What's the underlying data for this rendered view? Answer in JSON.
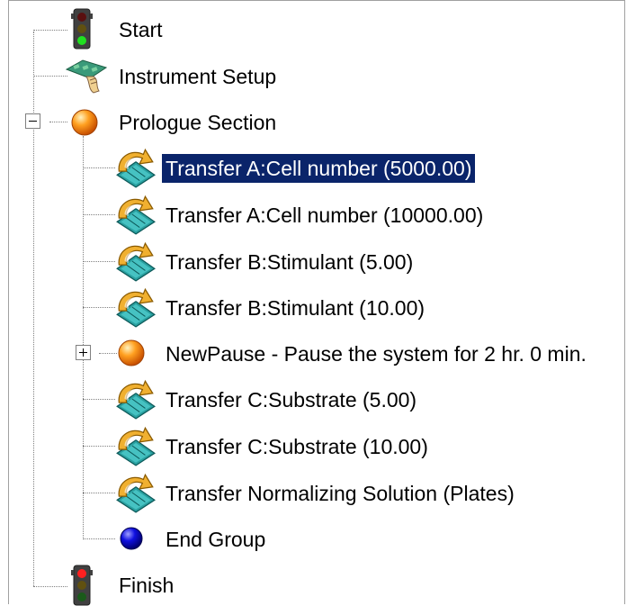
{
  "tree": {
    "root_items": {
      "start": {
        "label": "Start",
        "icon": "traffic-light-green-icon"
      },
      "instrument_setup": {
        "label": "Instrument Setup",
        "icon": "instrument-setup-icon"
      },
      "prologue": {
        "label": "Prologue Section",
        "icon": "orange-sphere-icon",
        "expanded": true
      },
      "finish": {
        "label": "Finish",
        "icon": "traffic-light-red-icon"
      }
    },
    "children": [
      {
        "label": "Transfer A:Cell number (5000.00)",
        "icon": "transfer-icon",
        "selected": true
      },
      {
        "label": "Transfer A:Cell number (10000.00)",
        "icon": "transfer-icon"
      },
      {
        "label": "Transfer B:Stimulant (5.00)",
        "icon": "transfer-icon"
      },
      {
        "label": "Transfer B:Stimulant (10.00)",
        "icon": "transfer-icon"
      },
      {
        "label": "NewPause - Pause the system for 2 hr. 0 min.",
        "icon": "orange-sphere-icon",
        "expanded": false
      },
      {
        "label": "Transfer C:Substrate (5.00)",
        "icon": "transfer-icon"
      },
      {
        "label": "Transfer C:Substrate (10.00)",
        "icon": "transfer-icon"
      },
      {
        "label": "Transfer Normalizing Solution (Plates)",
        "icon": "transfer-icon"
      },
      {
        "label": "End Group",
        "icon": "blue-sphere-icon"
      }
    ]
  },
  "colors": {
    "selection_bg": "#0a246a",
    "selection_text": "#ffffff",
    "orange_sphere": "#ff8c00",
    "blue_sphere": "#0000cc",
    "transfer_arrow": "#e8a020",
    "transfer_base": "#2aa0a0"
  }
}
